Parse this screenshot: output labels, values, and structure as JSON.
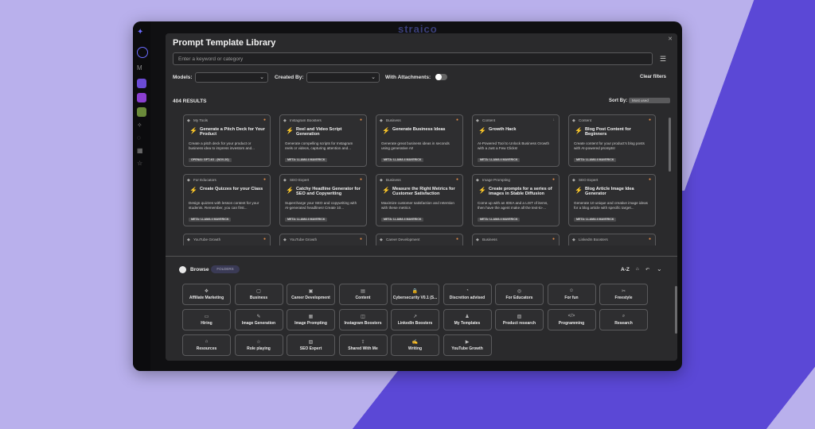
{
  "app": {
    "brand": "straico"
  },
  "library": {
    "title": "Prompt Template Library",
    "search_placeholder": "Enter a keyword or category",
    "filters": {
      "models_label": "Models:",
      "created_by_label": "Created By:",
      "attachments_label": "With Attachments:",
      "clear_label": "Clear filters"
    },
    "results_label": "404 RESULTS",
    "sort_label": "Sort By:",
    "sort_value": "Most used"
  },
  "cards": [
    {
      "category": "My Tools",
      "title": "Generate a Pitch Deck for Your Product",
      "desc": "Create a pitch deck for your product or business idea to impress investors and...",
      "model": "OPENAI: GPT-4O - (NOV-20)"
    },
    {
      "category": "Instagram Boosters",
      "title": "Reel and Video Script Generation",
      "desc": "Generate compelling scripts for Instagram reels or videos, capturing attention and...",
      "model": "META: LLAMA 4 MAVERICK"
    },
    {
      "category": "Business",
      "title": "Generate Business Ideas",
      "desc": "Generate great business ideas in seconds using generative AI!",
      "model": "META: LLAMA 4 MAVERICK"
    },
    {
      "category": "Content",
      "title": "Growth Hack",
      "desc": "AI-Powered Tool to Unlock Business Growth with a Just a Few Clicks!",
      "model": "META: LLAMA 4 MAVERICK"
    },
    {
      "category": "Content",
      "title": "Blog Post Content for Beginners",
      "desc": "Create content for your product's blog posts with AI-powered prompts!",
      "model": "META: LLAMA 4 MAVERICK"
    },
    {
      "category": "For Educators",
      "title": "Create Quizzes for your Class",
      "desc": "Design quizzes with lesson content for your students. Remember, you can first...",
      "model": "META: LLAMA 4 MAVERICK"
    },
    {
      "category": "SEO Expert",
      "title": "Catchy Headline Generator for SEO and Copywriting",
      "desc": "Supercharge your SEO and copywriting with AI-generated headlines! Create 10...",
      "model": "META: LLAMA 4 MAVERICK"
    },
    {
      "category": "Business",
      "title": "Measure the Right Metrics for Customer Satisfaction",
      "desc": "Maximize customer satisfaction and retention with these metrics",
      "model": "META: LLAMA 4 MAVERICK"
    },
    {
      "category": "Image Prompting",
      "title": "Create prompts for a series of images in Stable Diffusion",
      "desc": "Come up with an IDEA and a LIST of items, then have the agent make all the text-to-...",
      "model": "META: LLAMA 4 MAVERICK"
    },
    {
      "category": "SEO Expert",
      "title": "Blog Article Image Idea Generator",
      "desc": "Generate 10 unique and creative image ideas for a blog article with specific target...",
      "model": "META: LLAMA 4 MAVERICK"
    },
    {
      "category": "YouTube Growth",
      "title": "",
      "desc": "",
      "model": ""
    },
    {
      "category": "YouTube Growth",
      "title": "",
      "desc": "",
      "model": ""
    },
    {
      "category": "Career Development",
      "title": "",
      "desc": "",
      "model": ""
    },
    {
      "category": "Business",
      "title": "",
      "desc": "",
      "model": ""
    },
    {
      "category": "LinkedIn Boosters",
      "title": "",
      "desc": "",
      "model": ""
    }
  ],
  "browse": {
    "label": "Browse",
    "folders_tab": "FOLDERS",
    "sort_az": "A-Z",
    "folders": [
      {
        "label": "Affiliate Marketing",
        "icon": "❖"
      },
      {
        "label": "Business",
        "icon": "▢"
      },
      {
        "label": "Career Development",
        "icon": "▣"
      },
      {
        "label": "Content",
        "icon": "▤"
      },
      {
        "label": "Cybersecurity V0.1 (S...",
        "icon": "🔒"
      },
      {
        "label": "Discretion advised",
        "icon": "◔"
      },
      {
        "label": "For Educators",
        "icon": "◎"
      },
      {
        "label": "For fun",
        "icon": "☺"
      },
      {
        "label": "Freestyle",
        "icon": "✂"
      },
      {
        "label": "Hiring",
        "icon": "▭"
      },
      {
        "label": "Image Generation",
        "icon": "✎"
      },
      {
        "label": "Image Prompting",
        "icon": "▦"
      },
      {
        "label": "Instagram Boosters",
        "icon": "◫"
      },
      {
        "label": "LinkedIn Boosters",
        "icon": "↗"
      },
      {
        "label": "My Templates",
        "icon": "♟"
      },
      {
        "label": "Product research",
        "icon": "▧"
      },
      {
        "label": "Programming",
        "icon": "</>"
      },
      {
        "label": "Research",
        "icon": "⌕"
      },
      {
        "label": "Resources",
        "icon": "⌂"
      },
      {
        "label": "Role playing",
        "icon": "☆"
      },
      {
        "label": "SEO Expert",
        "icon": "▨"
      },
      {
        "label": "Shared With Me",
        "icon": "⇪"
      },
      {
        "label": "Writing",
        "icon": "✍"
      },
      {
        "label": "YouTube Growth",
        "icon": "▶"
      }
    ]
  },
  "colors": {
    "accent": "#5b48d6",
    "modal_bg": "#2a2a2c",
    "bolt": "#f4a030"
  }
}
